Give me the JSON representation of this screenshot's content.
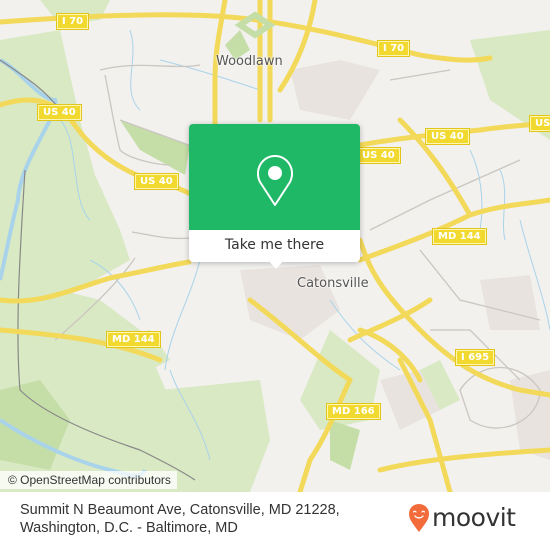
{
  "map": {
    "place_labels": [
      {
        "id": "woodlawn",
        "text": "Woodlawn"
      },
      {
        "id": "catonsville",
        "text": "Catonsville"
      }
    ],
    "road_shields": [
      {
        "id": "i70-west",
        "text": "I 70"
      },
      {
        "id": "i70-east",
        "text": "I 70"
      },
      {
        "id": "us40-west",
        "text": "US 40"
      },
      {
        "id": "us40-mid",
        "text": "US 40"
      },
      {
        "id": "us40-center",
        "text": "US 40"
      },
      {
        "id": "us40-east",
        "text": "US 40"
      },
      {
        "id": "us40-edge",
        "text": "US"
      },
      {
        "id": "md144-east",
        "text": "MD 144"
      },
      {
        "id": "md144-west",
        "text": "MD 144"
      },
      {
        "id": "i695",
        "text": "I 695"
      },
      {
        "id": "md166",
        "text": "MD 166"
      }
    ],
    "attribution": "© OpenStreetMap contributors",
    "colors": {
      "land": "#f2f1ee",
      "park": "#d7e8c0",
      "residential": "#e8e2df",
      "water": "#a9d3ea",
      "road_major": "#f7e36d",
      "road_minor": "#c9c5bf",
      "shield": "#f2d930"
    }
  },
  "popup": {
    "icon": "map-pin-icon",
    "button_label": "Take me there",
    "color": "#1fb866"
  },
  "footer": {
    "address_line1": "Summit N Beaumont Ave, Catonsville, MD 21228,",
    "address_line2": "Washington, D.C. - Baltimore, MD",
    "brand": "moovit",
    "brand_icon": "moovit-smiley-pin-icon",
    "brand_color": "#f26b3a"
  }
}
